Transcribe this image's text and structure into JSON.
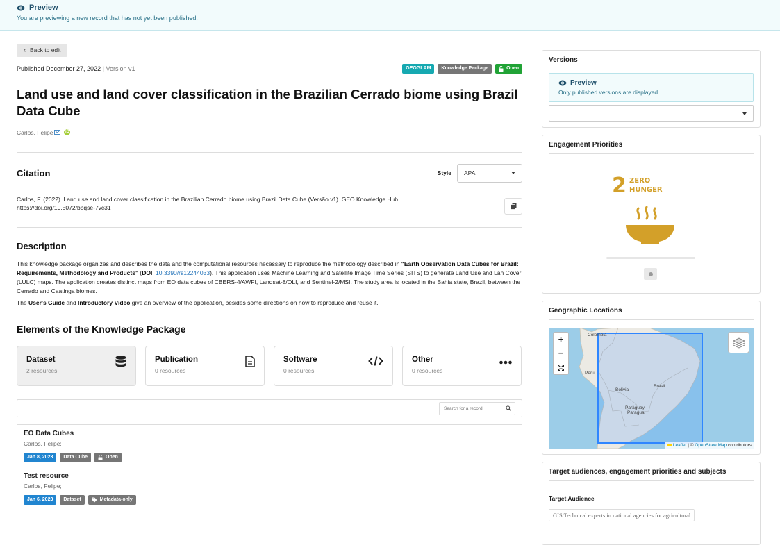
{
  "banner": {
    "title": "Preview",
    "text": "You are previewing a new record that has not yet been published."
  },
  "record": {
    "back_label": "Back to edit",
    "published": "Published December 27, 2022",
    "version": "Version v1",
    "badges": [
      "GEOGLAM",
      "Knowledge Package",
      "Open"
    ],
    "title": "Land use and land cover classification in the Brazilian Cerrado biome using Brazil Data Cube",
    "author": "Carlos, Felipe"
  },
  "citation": {
    "heading": "Citation",
    "style_label": "Style",
    "style_value": "APA",
    "text": "Carlos, F. (2022). Land use and land cover classification in the Brazilian Cerrado biome using Brazil Data Cube (Versão v1). GEO Knowledge Hub. https://doi.org/10.5072/bbqse-7vc31"
  },
  "description": {
    "heading": "Description",
    "p1_a": "This knowledge package organizes and describes the data and the computational resources necessary to reproduce the methodology described in ",
    "p1_bold": "\"Earth Observation Data Cubes for Brazil: Requirements, Methodology and Products\"",
    "p1_b": " (",
    "p1_doi_label": "DOI",
    "p1_c": ": ",
    "p1_doi": "10.3390/rs12244033",
    "p1_d": "). This application uses Machine Learning and Satellite Image Time Series (SITS) to generate Land Use and Lan Cover (LULC) maps. The application creates distinct maps from EO data cubes of CBERS-4/AWFI, Landsat-8/OLI, and Sentinel-2/MSI. The study area is located in the Bahia state, Brazil, between the Cerrado and Caatinga biomes.",
    "p2_a": "The ",
    "p2_bold1": "User's Guide",
    "p2_b": " and ",
    "p2_bold2": "Introductory Video",
    "p2_c": " give an overview of the application, besides some directions on how to reproduce and reuse it."
  },
  "elements": {
    "heading": "Elements of the Knowledge Package",
    "cards": [
      {
        "title": "Dataset",
        "count": "2 resources",
        "icon": "database-icon"
      },
      {
        "title": "Publication",
        "count": "0 resources",
        "icon": "document-icon"
      },
      {
        "title": "Software",
        "count": "0 resources",
        "icon": "code-icon"
      },
      {
        "title": "Other",
        "count": "0 resources",
        "icon": "more-icon"
      }
    ],
    "search_placeholder": "Search for a record",
    "records": [
      {
        "title": "EO Data Cubes",
        "author": "Carlos, Felipe;",
        "date": "Jan 8, 2023",
        "type": "Data Cube",
        "access": "Open"
      },
      {
        "title": "Test resource",
        "author": "Carlos, Felipe;",
        "date": "Jan 6, 2023",
        "type": "Dataset",
        "access": "Metadata-only"
      }
    ]
  },
  "sidebar": {
    "versions": {
      "title": "Versions",
      "preview_title": "Preview",
      "preview_text": "Only published versions are displayed."
    },
    "engagement": {
      "title": "Engagement Priorities",
      "sdg_number": "2",
      "sdg_line1": "ZERO",
      "sdg_line2": "HUNGER"
    },
    "geo": {
      "title": "Geographic Locations",
      "zoom_in": "+",
      "zoom_out": "−",
      "labels": [
        "Colombia",
        "Peru",
        "Bolivia",
        "Brasil",
        "Paraguay",
        "Paraguai"
      ],
      "attr_leaflet": "Leaflet",
      "attr_sep": " | © ",
      "attr_osm": "OpenStreetMap",
      "attr_tail": " contributors"
    },
    "audiences": {
      "title": "Target audiences, engagement priorities and subjects",
      "sub": "Target Audience",
      "tag": "GIS Technical experts in national agencies for agricultural"
    }
  },
  "colors": {
    "teal": "#16a9b1",
    "green": "#21a336",
    "blue": "#2185d0",
    "grey": "#767676",
    "sdg": "#d3a029"
  }
}
